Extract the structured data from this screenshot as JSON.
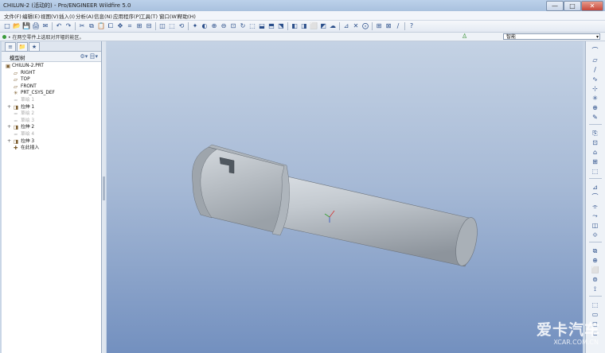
{
  "window": {
    "title": "CHILUN-2 (活动的) - Pro/ENGINEER Wildfire 5.0",
    "controls": {
      "minimize": "—",
      "maximize": "□",
      "close": "✕"
    }
  },
  "menu": [
    "文件(F)",
    "编辑(E)",
    "视图(V)",
    "插入(I)",
    "分析(A)",
    "信息(N)",
    "应用程序(P)",
    "工具(T)",
    "窗口(W)",
    "帮助(H)"
  ],
  "toolbar": {
    "icons": [
      "□",
      "📂",
      "💾",
      "🖨",
      "✉",
      "↶",
      "↷",
      "✂",
      "⧉",
      "📋",
      "⧠",
      "✥",
      "⌗",
      "⊞",
      "⊟",
      "◫",
      "⬚",
      "⟲",
      "✦",
      "◐",
      "⊕",
      "⊖",
      "⊡",
      "↻",
      "⬚",
      "⬓",
      "⬒",
      "⬔",
      "◧",
      "◨",
      "⬜",
      "◩",
      "☁",
      "⊿",
      "✕",
      "⨀",
      "⊞",
      "⊠",
      "∕",
      "?"
    ]
  },
  "message": {
    "text": "• 在两空零件上选取对开辐的能区。",
    "smart_select": "智能",
    "colors": {
      "ok": "#3a9a3a"
    }
  },
  "navigator": {
    "tabs": [
      "≡",
      "📁",
      "★"
    ],
    "tree_label": "模型树",
    "tree_tools": "⚙▾ 目▾"
  },
  "model_tree": [
    {
      "label": "CHILUN-2.PRT",
      "icon": "▣",
      "expand": "",
      "gray": false,
      "indent": 0
    },
    {
      "label": "RIGHT",
      "icon": "▱",
      "expand": "",
      "gray": false,
      "indent": 1
    },
    {
      "label": "TOP",
      "icon": "▱",
      "expand": "",
      "gray": false,
      "indent": 1
    },
    {
      "label": "FRONT",
      "icon": "▱",
      "expand": "",
      "gray": false,
      "indent": 1
    },
    {
      "label": "PRT_CSYS_DEF",
      "icon": "✳",
      "expand": "",
      "gray": false,
      "indent": 1
    },
    {
      "label": "草绘 1",
      "icon": "≈",
      "expand": "",
      "gray": true,
      "indent": 1
    },
    {
      "label": "拉伸 1",
      "icon": "◨",
      "expand": "+",
      "gray": false,
      "indent": 1
    },
    {
      "label": "草绘 2",
      "icon": "≈",
      "expand": "",
      "gray": true,
      "indent": 1
    },
    {
      "label": "草绘 3",
      "icon": "≈",
      "expand": "",
      "gray": true,
      "indent": 1
    },
    {
      "label": "拉伸 2",
      "icon": "◨",
      "expand": "+",
      "gray": false,
      "indent": 1
    },
    {
      "label": "草绘 4",
      "icon": "≈",
      "expand": "",
      "gray": true,
      "indent": 1
    },
    {
      "label": "拉伸 3",
      "icon": "◨",
      "expand": "+",
      "gray": false,
      "indent": 1
    },
    {
      "label": "在此插入",
      "icon": "✚",
      "expand": "",
      "gray": false,
      "indent": 1
    }
  ],
  "right_toolbar": [
    "⌒",
    "▱",
    "∕",
    "∿",
    "⊹",
    "✳",
    "⊕",
    "✎",
    "⎘",
    "⊡",
    "⌂",
    "⊞",
    "⬚",
    "⊿",
    "⌒",
    "⌯",
    "⤳",
    "◫",
    "⟐",
    "⧉",
    "⊕",
    "⬜",
    "⊚",
    "⟟",
    "⬚",
    "▭",
    "◻",
    "⊏"
  ],
  "viewport": {
    "background_top": "#c4d2e4",
    "background_bottom": "#7390bf",
    "model_fill": "#b8c0c8"
  },
  "watermark": {
    "big": "爱卡汽车",
    "small": "XCAR.COM.CN"
  }
}
